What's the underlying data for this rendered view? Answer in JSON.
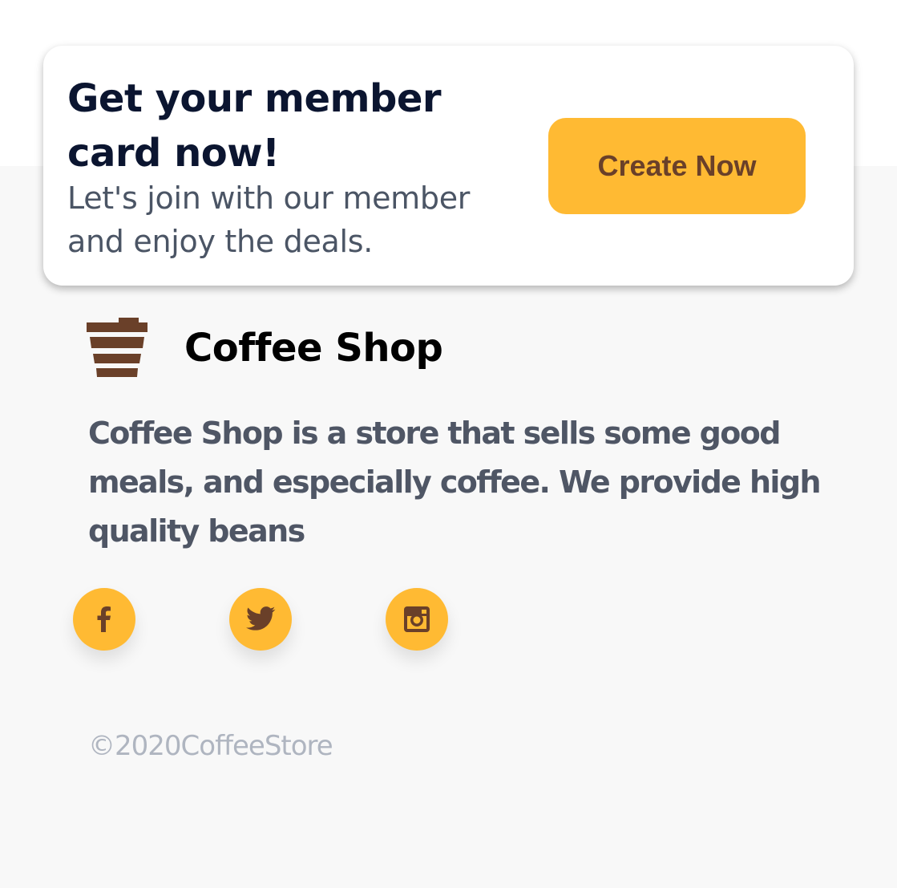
{
  "member_card": {
    "title": "Get your member card now!",
    "subtitle": "Let's join with our member and enjoy the deals.",
    "button_label": "Create Now"
  },
  "brand": {
    "logo_icon": "coffee-cup-icon",
    "name": "Coffee Shop"
  },
  "description": "Coffee Shop is a store that sells some good meals, and especially coffee. We provide high quality beans",
  "social_links": [
    {
      "name": "facebook",
      "icon": "facebook-icon"
    },
    {
      "name": "twitter",
      "icon": "twitter-icon"
    },
    {
      "name": "instagram",
      "icon": "instagram-icon"
    }
  ],
  "copyright": "©2020CoffeeStore",
  "colors": {
    "accent": "#ffba33",
    "brown": "#6a4029",
    "logo": "#6a4029",
    "title": "#0b1530",
    "text": "#4f5665",
    "muted": "#afb5c0",
    "footer_bg": "#f8f8f8"
  }
}
